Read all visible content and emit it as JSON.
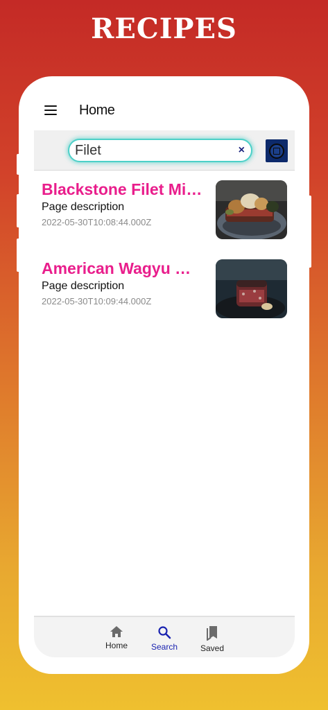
{
  "banner": {
    "title": "RECIPES"
  },
  "app_bar": {
    "title": "Home",
    "menu_icon": "hamburger-menu-icon"
  },
  "search": {
    "value": "Filet",
    "clear_glyph": "×",
    "clear_icon": "close-icon",
    "accent_color": "#4dd0c8"
  },
  "results": [
    {
      "title": "Blackstone Filet Mig...",
      "description": "Page description",
      "date": "2022-05-30T10:08:44.000Z"
    },
    {
      "title": "American Wagyu Ma...",
      "description": "Page description",
      "date": "2022-05-30T10:09:44.000Z"
    }
  ],
  "bottom_nav": {
    "items": [
      {
        "label": "Home",
        "icon": "home-icon",
        "active": false
      },
      {
        "label": "Search",
        "icon": "search-icon",
        "active": true
      },
      {
        "label": "Saved",
        "icon": "bookmarks-icon",
        "active": false
      }
    ]
  },
  "colors": {
    "title_pink": "#e91e8c",
    "active_nav": "#1a23b0",
    "banner_gradient_top": "#c42a26",
    "banner_gradient_bottom": "#efc02f"
  }
}
